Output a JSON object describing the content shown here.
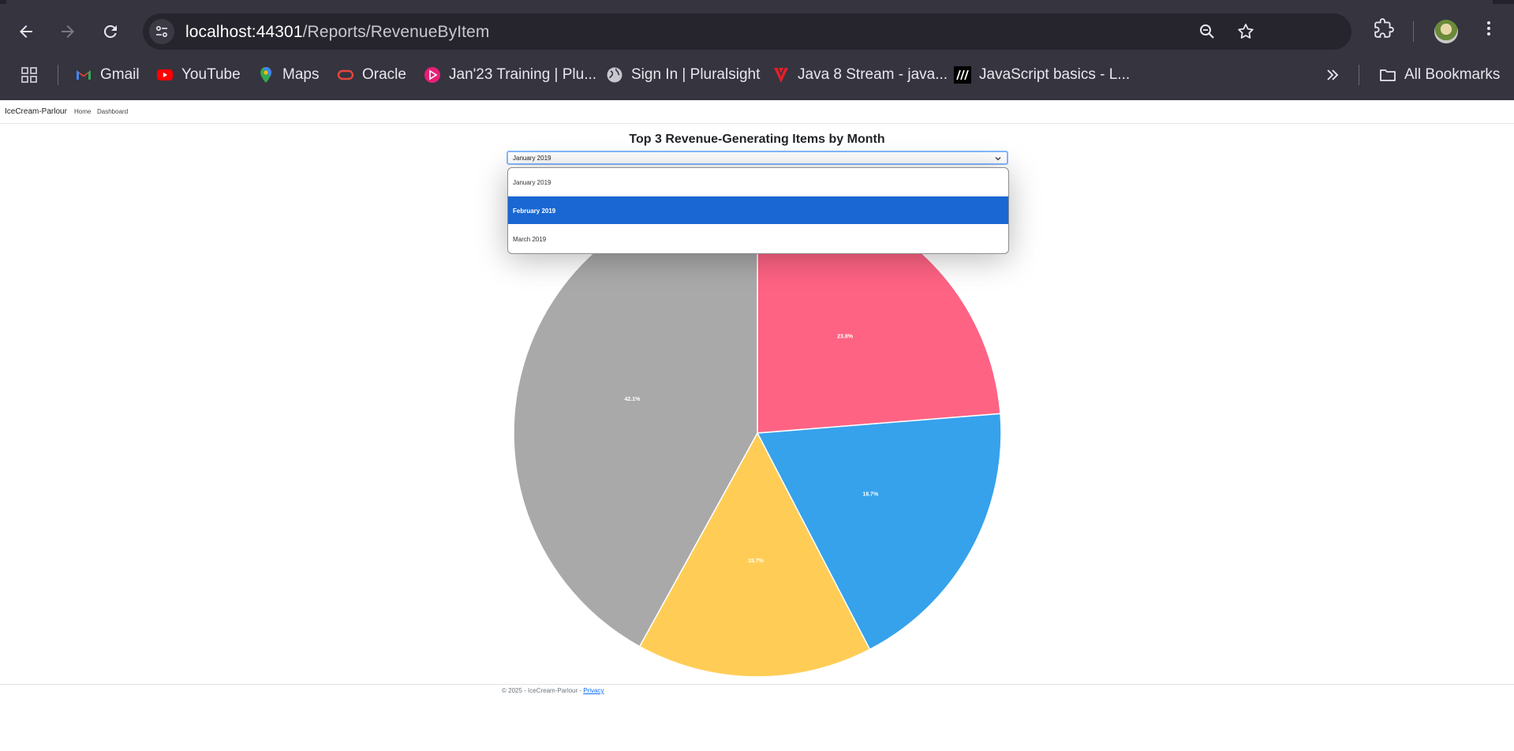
{
  "browser": {
    "url_host": "localhost:44301",
    "url_path": "/Reports/RevenueByItem",
    "bookmarks": [
      {
        "label": "Gmail"
      },
      {
        "label": "YouTube"
      },
      {
        "label": "Maps"
      },
      {
        "label": "Oracle"
      },
      {
        "label": "Jan'23 Training | Plu..."
      },
      {
        "label": "Sign In | Pluralsight"
      },
      {
        "label": "Java 8 Stream - java..."
      },
      {
        "label": "JavaScript basics - L..."
      }
    ],
    "all_bookmarks": "All Bookmarks"
  },
  "app": {
    "brand": "IceCream-Parlour",
    "nav": [
      "Home",
      "Dashboard"
    ]
  },
  "page": {
    "title": "Top 3 Revenue-Generating Items by Month",
    "month_select": {
      "value": "January 2019",
      "options": [
        "January 2019",
        "February 2019",
        "March 2019"
      ],
      "highlighted": "February 2019"
    }
  },
  "chart_data": {
    "type": "pie",
    "series": [
      {
        "label": "23.8%",
        "value": 23.8,
        "color": "#ff6384"
      },
      {
        "label": "18.7%",
        "value": 18.7,
        "color": "#36a2eb"
      },
      {
        "label": "15.7%",
        "value": 15.7,
        "color": "#ffcd56"
      },
      {
        "label": "42.1%",
        "value": 42.1,
        "color": "#a9a9a9"
      }
    ]
  },
  "footer": {
    "text": "© 2025 - IceCream-Parlour - ",
    "link": "Privacy"
  }
}
